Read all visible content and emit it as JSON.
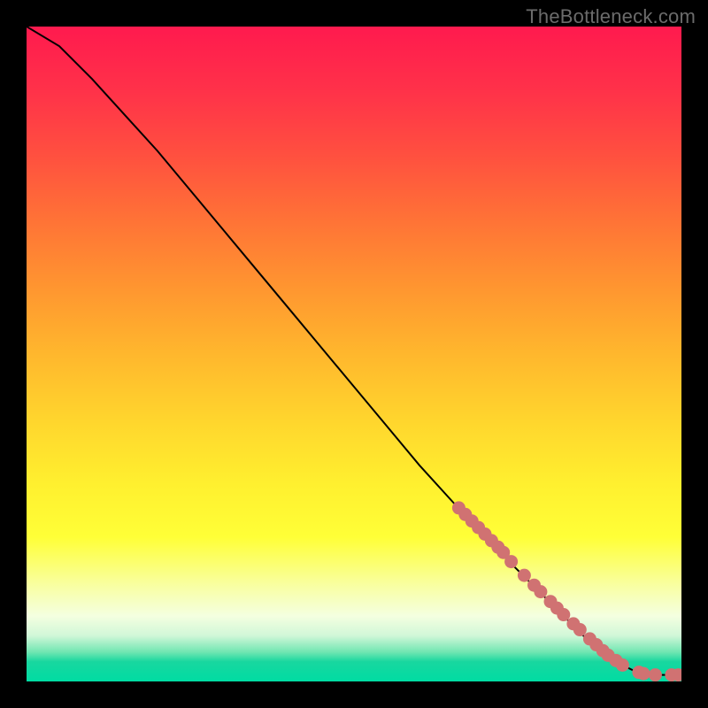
{
  "attribution": "TheBottleneck.com",
  "colors": {
    "bg": "#000000",
    "curve": "#000000",
    "marker_fill": "#d07272",
    "marker_stroke": "#8a3a3a",
    "gradient": [
      {
        "stop": 0.0,
        "c": "#ff1a4e"
      },
      {
        "stop": 0.1,
        "c": "#ff3249"
      },
      {
        "stop": 0.2,
        "c": "#ff513f"
      },
      {
        "stop": 0.3,
        "c": "#ff7436"
      },
      {
        "stop": 0.4,
        "c": "#ff9630"
      },
      {
        "stop": 0.5,
        "c": "#ffb72d"
      },
      {
        "stop": 0.6,
        "c": "#ffd52d"
      },
      {
        "stop": 0.7,
        "c": "#fff02f"
      },
      {
        "stop": 0.78,
        "c": "#ffff37"
      },
      {
        "stop": 0.86,
        "c": "#f8ffab"
      },
      {
        "stop": 0.9,
        "c": "#f4ffe0"
      },
      {
        "stop": 0.93,
        "c": "#d1f7d8"
      },
      {
        "stop": 0.955,
        "c": "#71e6b2"
      },
      {
        "stop": 0.97,
        "c": "#18d79f"
      },
      {
        "stop": 1.0,
        "c": "#00dca3"
      }
    ]
  },
  "chart_data": {
    "type": "line",
    "title": "",
    "xlabel": "",
    "ylabel": "",
    "xlim": [
      0,
      100
    ],
    "ylim": [
      0,
      100
    ],
    "grid": false,
    "legend": false,
    "comment": "Decreasing bottleneck curve with highlighted data markers",
    "series": [
      {
        "name": "curve",
        "style": "line",
        "x": [
          0,
          5,
          10,
          15,
          20,
          25,
          30,
          35,
          40,
          45,
          50,
          55,
          60,
          65,
          70,
          75,
          80,
          85,
          90,
          93,
          96,
          98,
          100
        ],
        "y": [
          100,
          97,
          92,
          86.5,
          81,
          75,
          69,
          63,
          57,
          51,
          45,
          39,
          33,
          27.5,
          22,
          17,
          12,
          7,
          3,
          1.5,
          1.0,
          1.0,
          1.0
        ]
      },
      {
        "name": "markers",
        "style": "points",
        "x": [
          66,
          67,
          68,
          69,
          70,
          71,
          72,
          72.8,
          74,
          76,
          77.5,
          78.5,
          80,
          81,
          82,
          83.5,
          84.5,
          86,
          87,
          88,
          88.8,
          90,
          91,
          93.5,
          94.2,
          96,
          98.5,
          99.5
        ],
        "y": [
          26.5,
          25.5,
          24.5,
          23.5,
          22.5,
          21.5,
          20.5,
          19.7,
          18.3,
          16.2,
          14.7,
          13.7,
          12.2,
          11.2,
          10.2,
          8.8,
          7.9,
          6.5,
          5.6,
          4.7,
          4.0,
          3.2,
          2.5,
          1.4,
          1.2,
          1.0,
          1.0,
          1.0
        ]
      }
    ]
  }
}
